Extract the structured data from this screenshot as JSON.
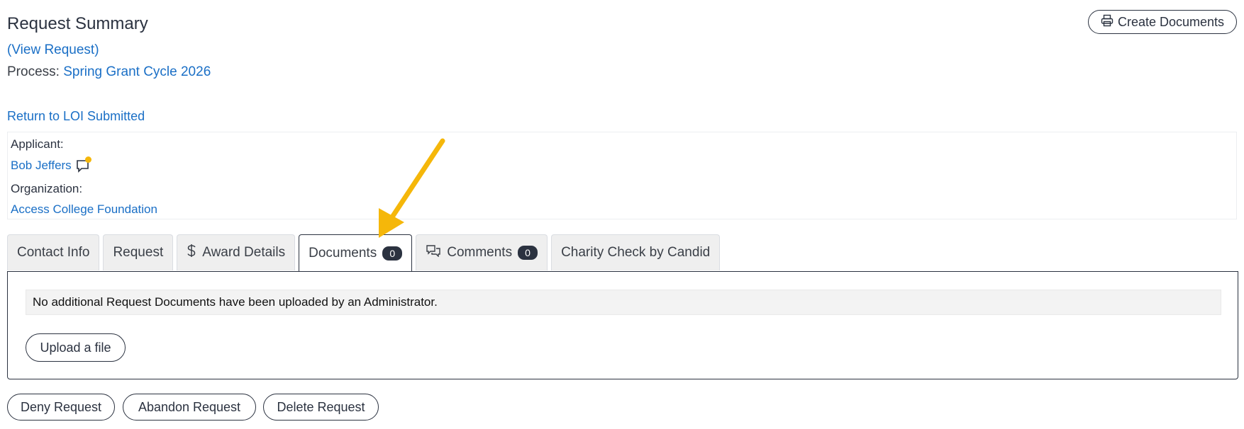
{
  "header": {
    "title": "Request Summary",
    "view_request_link": "(View Request)",
    "process_label": "Process:",
    "process_value": "Spring Grant Cycle 2026",
    "return_link": "Return to LOI Submitted",
    "create_documents_label": "Create Documents"
  },
  "applicant_panel": {
    "applicant_label": "Applicant:",
    "applicant_name": "Bob Jeffers",
    "organization_label": "Organization:",
    "organization_name": "Access College Foundation"
  },
  "tabs": [
    {
      "label": "Contact Info"
    },
    {
      "label": "Request"
    },
    {
      "label": "Award Details",
      "icon": "dollar-icon"
    },
    {
      "label": "Documents",
      "count": "0",
      "active": true
    },
    {
      "label": "Comments",
      "icon": "comments-icon",
      "count": "0"
    },
    {
      "label": "Charity Check by Candid"
    }
  ],
  "documents_panel": {
    "notice": "No additional Request Documents have been uploaded by an Administrator.",
    "upload_label": "Upload a file"
  },
  "actions": {
    "deny_label": "Deny Request",
    "abandon_label": "Abandon Request",
    "delete_label": "Delete Request"
  },
  "colors": {
    "link": "#1a6fc6",
    "text_dark": "#2b3240",
    "annotation_arrow": "#f5b70a",
    "notification_dot": "#f5b70a"
  }
}
